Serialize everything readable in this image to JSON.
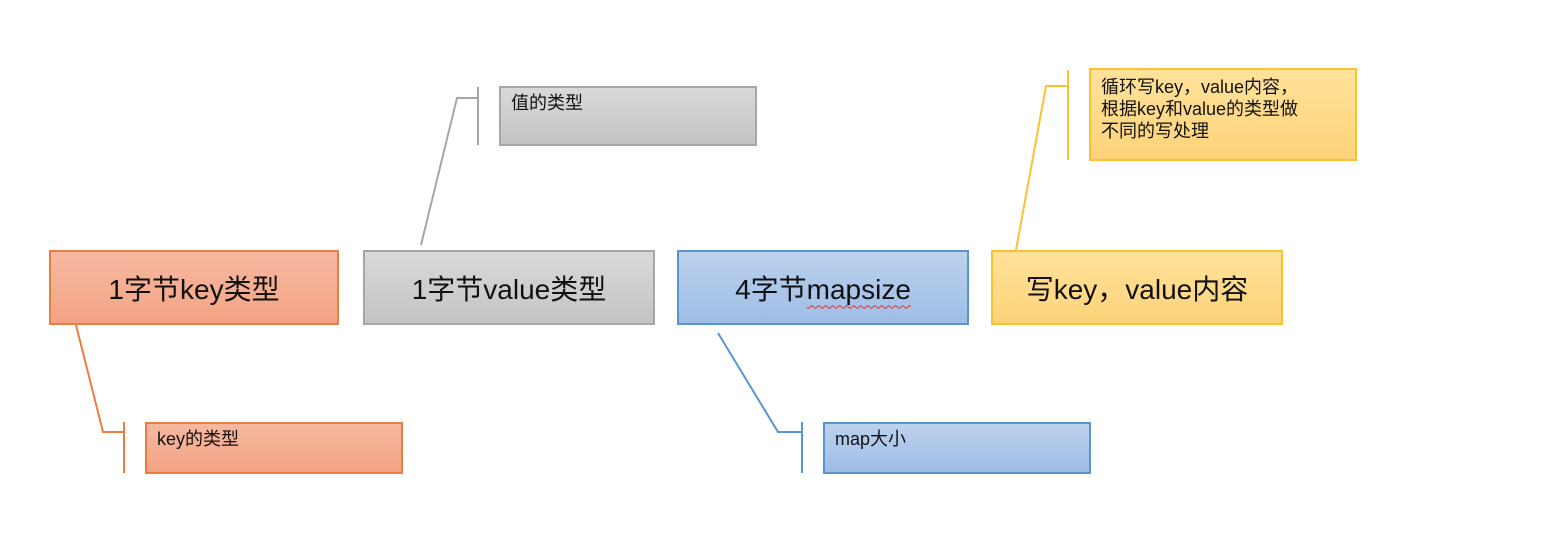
{
  "boxes": {
    "key_type": {
      "text": "1字节key类型"
    },
    "value_type": {
      "text": "1字节value类型"
    },
    "mapsize": {
      "prefix": "4字节",
      "suffix": "mapsize"
    },
    "kv_content": {
      "text": "写key，value内容"
    }
  },
  "callouts": {
    "key_type": {
      "text": "key的类型"
    },
    "value_type": {
      "text": "值的类型"
    },
    "mapsize": {
      "text": "map大小"
    },
    "kv_content": {
      "lines": [
        "循环写key，value内容，",
        "根据key和value的类型做",
        "不同的写处理"
      ]
    }
  },
  "colors": {
    "orange_accent": "#ec7d41",
    "gray_accent": "#a6a6a6",
    "blue_accent": "#5b95d0",
    "yellow_accent": "#fbc131"
  }
}
